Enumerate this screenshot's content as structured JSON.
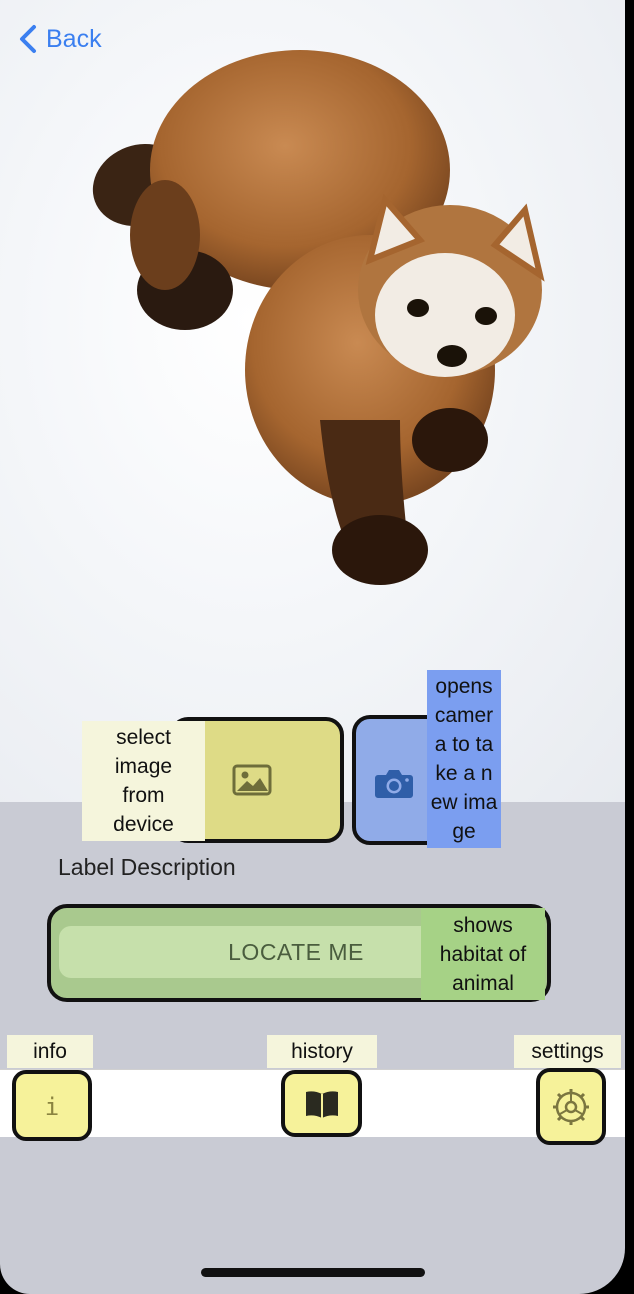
{
  "nav": {
    "back_label": "Back"
  },
  "photo": {
    "subject": "marten-in-snow"
  },
  "buttons": {
    "select_image_tip": "select image from device",
    "camera_tip": "opens camer a to take a new image"
  },
  "label_description": "Label Description",
  "locate": {
    "label": "LOCATE ME",
    "tip": "shows habitat of animal"
  },
  "tabs": [
    {
      "label": "info"
    },
    {
      "label": "history"
    },
    {
      "label": "settings"
    }
  ],
  "colors": {
    "accent": "#3b7ff0",
    "image_button": "#dedb86",
    "camera_button": "#90abe8",
    "locate_button": "#a9c98e",
    "tab_button": "#f6f29a",
    "background": "#c9cbd4"
  }
}
